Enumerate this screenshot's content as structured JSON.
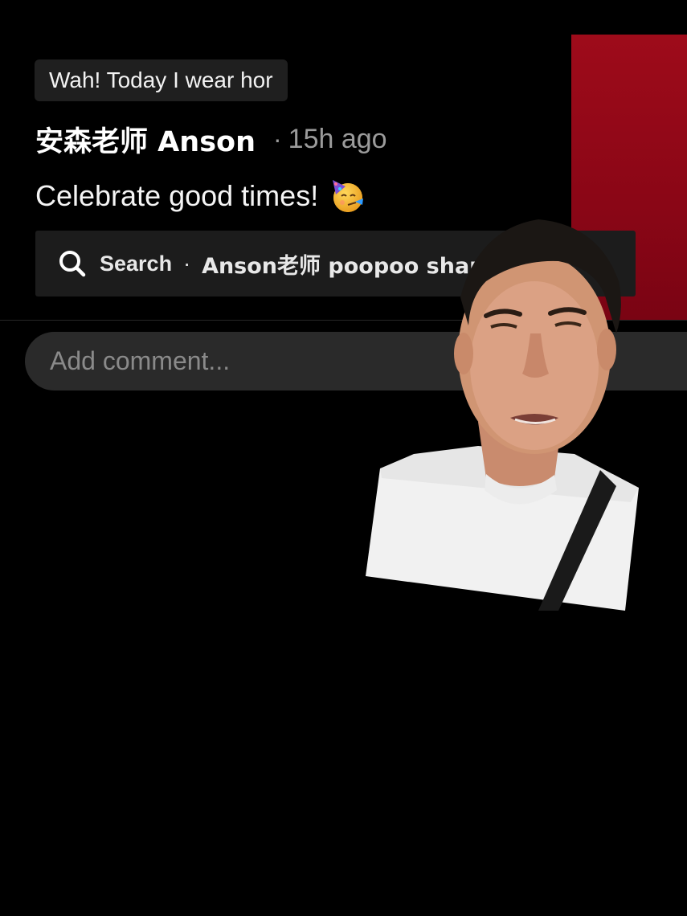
{
  "video": {
    "caption_chip": "Wah! Today I wear hor",
    "author": {
      "name": "安森老师 Anson",
      "separator": "·",
      "time_ago": "15h ago"
    },
    "description": "Celebrate good times!",
    "description_emoji": "partying-face-icon"
  },
  "search": {
    "icon": "search-icon",
    "label": "Search",
    "separator": "·",
    "query": "Anson老师  poopoo shape"
  },
  "comment": {
    "placeholder": "Add comment..."
  },
  "colors": {
    "background": "#000000",
    "chip_bg": "#1f1f1f",
    "search_bg": "#1c1c1c",
    "comment_bg": "#2a2a2a",
    "muted_text": "#9b9b9b",
    "red_block": "#9e0b1a"
  }
}
